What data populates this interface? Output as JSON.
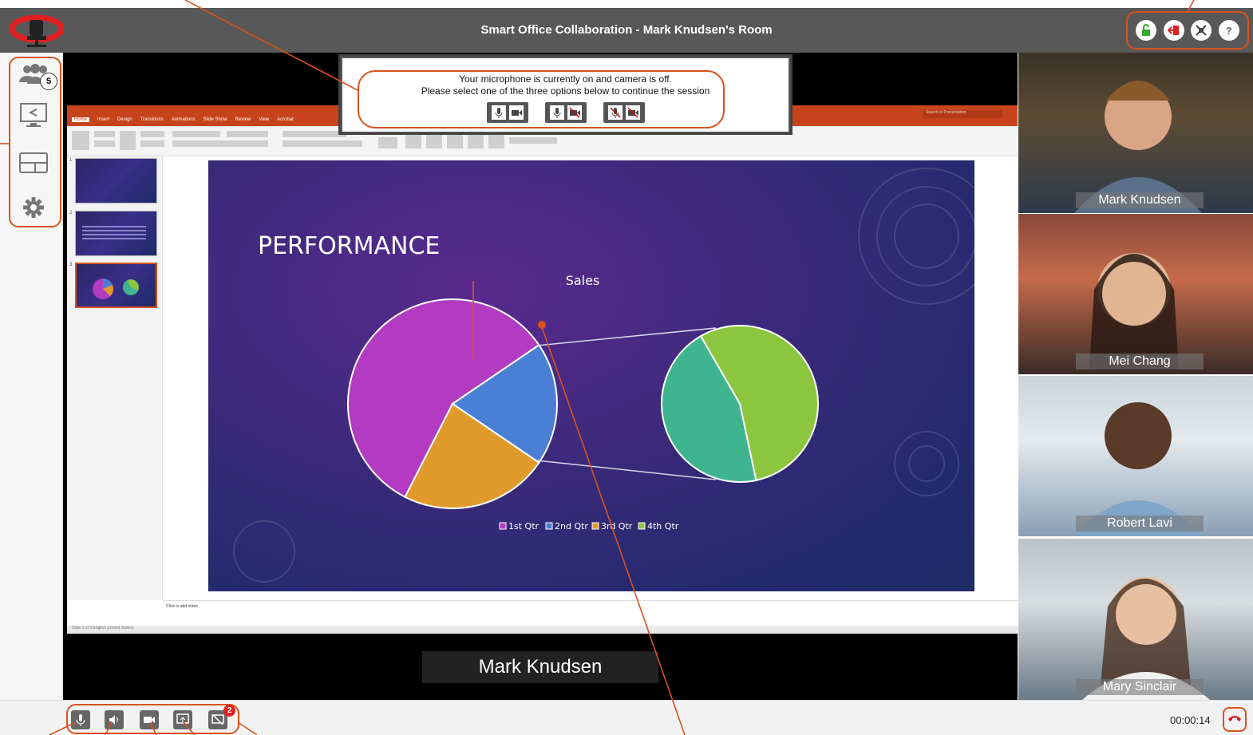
{
  "window": {
    "title": "Smart Office Collaboration - Mark Knudsen's Room"
  },
  "sidebar": {
    "participants_count": "5",
    "items": [
      {
        "icon": "participants-icon"
      },
      {
        "icon": "screen-share-icon"
      },
      {
        "icon": "layout-icon"
      },
      {
        "icon": "settings-gear-icon"
      }
    ]
  },
  "top_actions": {
    "items": [
      {
        "icon": "unlock-icon",
        "color": "#2fae2f"
      },
      {
        "icon": "exit-icon",
        "color": "#e02020"
      },
      {
        "icon": "collapse-icon",
        "color": "#555555"
      },
      {
        "icon": "help-icon",
        "label": "?"
      }
    ]
  },
  "dialog": {
    "line1": "Your microphone is currently on and camera is off.",
    "line2": "Please select one of the three options below to continue the session"
  },
  "powerpoint": {
    "tabs": [
      "Home",
      "Insert",
      "Design",
      "Transitions",
      "Animations",
      "Slide Show",
      "Review",
      "View",
      "Acrobat"
    ],
    "search_placeholder": "Search in Presentation",
    "slide_numbers": [
      "1",
      "2",
      "3"
    ],
    "notes_placeholder": "Click to add notes",
    "status": "Slide 3 of 3    English (United States)",
    "slide": {
      "title": "PERFORMANCE",
      "chart_title": "Sales"
    }
  },
  "chart_data": {
    "type": "pie",
    "title": "Sales",
    "categories": [
      "1st Qtr",
      "2nd Qtr",
      "3rd Qtr",
      "4th Qtr"
    ],
    "values": [
      58,
      19,
      23,
      0
    ],
    "secondary_pie": {
      "type": "pie",
      "values": [
        55,
        45
      ]
    },
    "colors": [
      "#b23bc2",
      "#4a7fd6",
      "#e09a2c",
      "#8cc63f"
    ],
    "legend_position": "bottom"
  },
  "active_speaker": {
    "name": "Mark Knudsen"
  },
  "videos": [
    {
      "name": "Mark Knudsen"
    },
    {
      "name": "Mei Chang"
    },
    {
      "name": "Robert Lavi"
    },
    {
      "name": "Mary Sinclair"
    }
  ],
  "controls": {
    "items": [
      {
        "icon": "microphone-icon"
      },
      {
        "icon": "speaker-icon"
      },
      {
        "icon": "camera-icon"
      },
      {
        "icon": "share-screen-icon"
      },
      {
        "icon": "chat-icon"
      }
    ],
    "chat_badge": "2",
    "timer": "00:00:14",
    "hangup_icon": "hangup-icon"
  },
  "theme": {
    "accent": "#d9531e",
    "topbar": "#585858"
  }
}
